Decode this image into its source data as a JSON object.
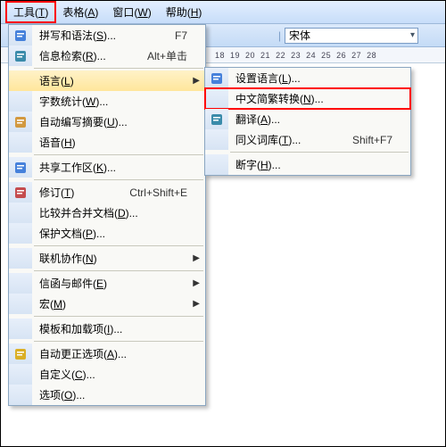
{
  "menubar": {
    "items": [
      {
        "label": "工具(",
        "accel": "T",
        "tail": ")"
      },
      {
        "label": "表格(",
        "accel": "A",
        "tail": ")"
      },
      {
        "label": "窗口(",
        "accel": "W",
        "tail": ")"
      },
      {
        "label": "帮助(",
        "accel": "H",
        "tail": ")"
      }
    ]
  },
  "toolbar": {
    "font": "宋体"
  },
  "ruler": {
    "marks": [
      "18",
      "19",
      "20",
      "21",
      "22",
      "23",
      "24",
      "25",
      "26",
      "27",
      "28"
    ]
  },
  "tools_menu": {
    "items": [
      {
        "label": "拼写和语法(",
        "accel": "S",
        "tail": ")...",
        "shortcut": "F7",
        "icon": "spell"
      },
      {
        "label": "信息检索(",
        "accel": "R",
        "tail": ")...",
        "shortcut": "Alt+单击",
        "icon": "research"
      },
      {
        "label": "语言(",
        "accel": "L",
        "tail": ")",
        "submenu": true,
        "selected": true
      },
      {
        "label": "字数统计(",
        "accel": "W",
        "tail": ")..."
      },
      {
        "label": "自动编写摘要(",
        "accel": "U",
        "tail": ")...",
        "icon": "summary"
      },
      {
        "label": "语音(",
        "accel": "H",
        "tail": ")"
      },
      {
        "label": "共享工作区(",
        "accel": "K",
        "tail": ")...",
        "icon": "shared"
      },
      {
        "label": "修订(",
        "accel": "T",
        "tail": ")",
        "shortcut": "Ctrl+Shift+E",
        "icon": "track"
      },
      {
        "label": "比较并合并文档(",
        "accel": "D",
        "tail": ")..."
      },
      {
        "label": "保护文档(",
        "accel": "P",
        "tail": ")..."
      },
      {
        "label": "联机协作(",
        "accel": "N",
        "tail": ")",
        "submenu": true
      },
      {
        "label": "信函与邮件(",
        "accel": "E",
        "tail": ")",
        "submenu": true
      },
      {
        "label": "宏(",
        "accel": "M",
        "tail": ")",
        "submenu": true
      },
      {
        "label": "模板和加载项(",
        "accel": "I",
        "tail": ")..."
      },
      {
        "label": "自动更正选项(",
        "accel": "A",
        "tail": ")...",
        "icon": "autocorrect"
      },
      {
        "label": "自定义(",
        "accel": "C",
        "tail": ")..."
      },
      {
        "label": "选项(",
        "accel": "O",
        "tail": ")..."
      }
    ],
    "sep_after": [
      1,
      5,
      6,
      9,
      10,
      12,
      13
    ]
  },
  "language_submenu": {
    "items": [
      {
        "label": "设置语言(",
        "accel": "L",
        "tail": ")...",
        "icon": "setlang"
      },
      {
        "label": "中文简繁转换(",
        "accel": "N",
        "tail": ")...",
        "hlred": true
      },
      {
        "label": "翻译(",
        "accel": "A",
        "tail": ")...",
        "icon": "translate"
      },
      {
        "label": "同义词库(",
        "accel": "T",
        "tail": ")...",
        "shortcut": "Shift+F7"
      },
      {
        "label": "断字(",
        "accel": "H",
        "tail": ")..."
      }
    ],
    "sep_after": [
      3
    ]
  }
}
